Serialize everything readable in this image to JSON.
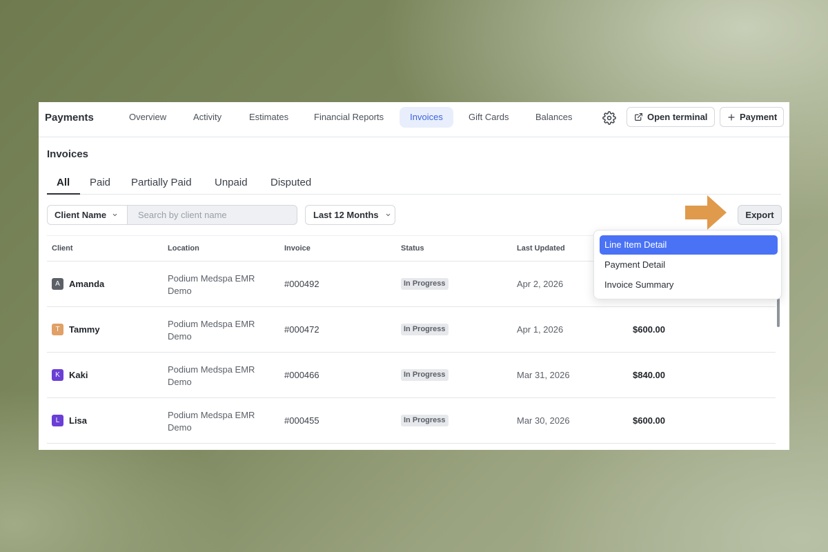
{
  "topnav": {
    "brand": "Payments",
    "tabs": [
      {
        "label": "Overview"
      },
      {
        "label": "Activity"
      },
      {
        "label": "Estimates"
      },
      {
        "label": "Financial Reports"
      },
      {
        "label": "Invoices",
        "active": true
      },
      {
        "label": "Gift Cards"
      },
      {
        "label": "Balances"
      }
    ],
    "settings_icon": "gear-icon",
    "open_terminal_label": "Open terminal",
    "open_terminal_icon": "external-link-icon",
    "payment_label": "Payment",
    "payment_icon": "plus-icon"
  },
  "section": {
    "title": "Invoices",
    "subtabs": [
      {
        "label": "All",
        "active": true
      },
      {
        "label": "Paid"
      },
      {
        "label": "Partially Paid"
      },
      {
        "label": "Unpaid"
      },
      {
        "label": "Disputed"
      }
    ]
  },
  "filters": {
    "client_filter_label": "Client Name",
    "search_placeholder": "Search by client name",
    "date_filter_label": "Last 12 Months",
    "export_label": "Export"
  },
  "table": {
    "headers": [
      "Client",
      "Location",
      "Invoice",
      "Status",
      "Last Updated"
    ],
    "rows": [
      {
        "initial": "A",
        "avatar_color": "#5c6168",
        "client": "Amanda",
        "location": "Podium Medspa EMR Demo",
        "invoice": "#000492",
        "status": "In Progress",
        "updated": "Apr 2, 2026",
        "amount": ""
      },
      {
        "initial": "T",
        "avatar_color": "#e0a066",
        "client": "Tammy",
        "location": "Podium Medspa EMR Demo",
        "invoice": "#000472",
        "status": "In Progress",
        "updated": "Apr 1, 2026",
        "amount": "$600.00"
      },
      {
        "initial": "K",
        "avatar_color": "#6a3fd6",
        "client": "Kaki",
        "location": "Podium Medspa EMR Demo",
        "invoice": "#000466",
        "status": "In Progress",
        "updated": "Mar 31, 2026",
        "amount": "$840.00"
      },
      {
        "initial": "L",
        "avatar_color": "#6a3fd6",
        "client": "Lisa",
        "location": "Podium Medspa EMR Demo",
        "invoice": "#000455",
        "status": "In Progress",
        "updated": "Mar 30, 2026",
        "amount": "$600.00"
      }
    ]
  },
  "export_menu": {
    "items": [
      {
        "label": "Line Item Detail",
        "active": true
      },
      {
        "label": "Payment Detail"
      },
      {
        "label": "Invoice Summary"
      }
    ]
  },
  "colors": {
    "accent": "#3a63e0",
    "menu_highlight": "#4a72f5",
    "arrow": "#e09a4c"
  }
}
